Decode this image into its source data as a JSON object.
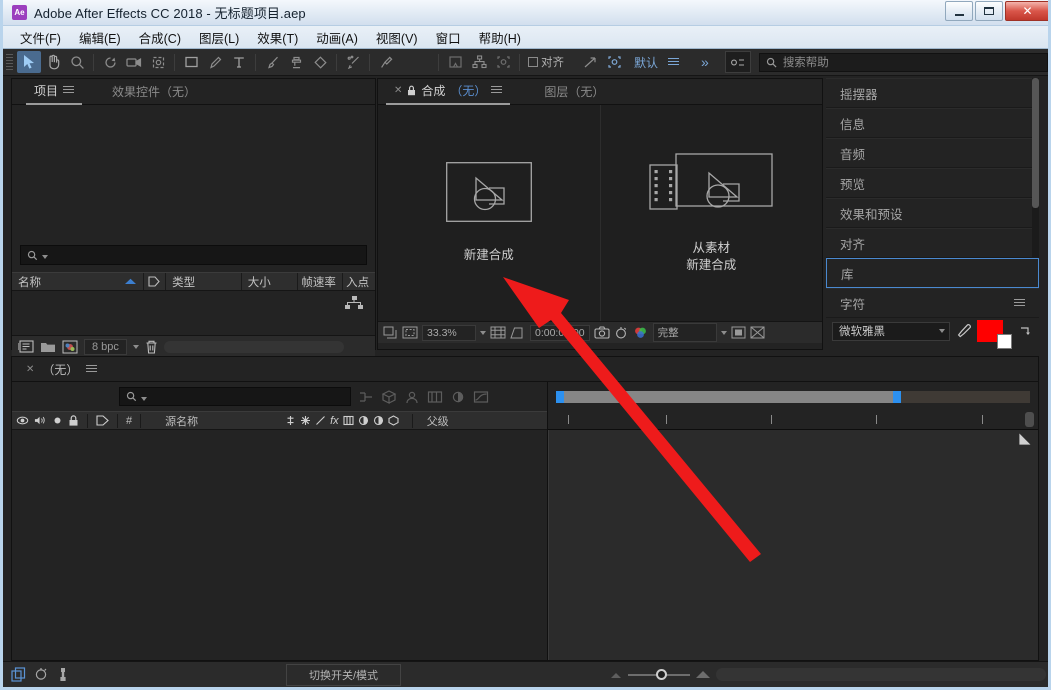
{
  "window": {
    "app_badge": "Ae",
    "title": "Adobe After Effects CC 2018 - 无标题项目.aep",
    "buttons": {
      "minimize": "—",
      "restore": "❐",
      "close": "✕"
    }
  },
  "menubar": {
    "items": [
      {
        "label": "文件(F)"
      },
      {
        "label": "编辑(E)"
      },
      {
        "label": "合成(C)"
      },
      {
        "label": "图层(L)"
      },
      {
        "label": "效果(T)"
      },
      {
        "label": "动画(A)"
      },
      {
        "label": "视图(V)"
      },
      {
        "label": "窗口"
      },
      {
        "label": "帮助(H)"
      }
    ]
  },
  "toolbar": {
    "tools": [
      {
        "name": "selection-tool",
        "active": true
      },
      {
        "name": "hand-tool",
        "active": false
      },
      {
        "name": "zoom-tool",
        "active": false
      },
      {
        "name": "rotation-tool",
        "active": false
      },
      {
        "name": "camera-tool",
        "active": false
      },
      {
        "name": "pan-behind-tool",
        "active": false
      },
      {
        "name": "shape-tool",
        "active": false
      },
      {
        "name": "pen-tool",
        "active": false
      },
      {
        "name": "type-tool",
        "active": false
      },
      {
        "name": "brush-tool",
        "active": false
      },
      {
        "name": "clone-stamp-tool",
        "active": false
      },
      {
        "name": "eraser-tool",
        "active": false
      },
      {
        "name": "roto-brush-tool",
        "active": false
      },
      {
        "name": "puppet-pin-tool",
        "active": false
      }
    ],
    "snap_label": "对齐",
    "workspace_name": "默认",
    "overflow_label": "»",
    "search_placeholder": "搜索帮助"
  },
  "project_panel": {
    "tabs": [
      {
        "label": "项目",
        "active": true
      },
      {
        "label": "效果控件（无）",
        "active": false
      }
    ],
    "search_placeholder": "",
    "columns": [
      "名称",
      "类型",
      "大小",
      "帧速率",
      "入点"
    ],
    "rows": [],
    "footer": {
      "bit_depth": "8 bpc"
    }
  },
  "comp_panel": {
    "tabs": [
      {
        "label": "合成",
        "suffix": "（无）",
        "active": true
      },
      {
        "label": "图层（无）",
        "active": false
      }
    ],
    "actions": [
      {
        "name": "new-composition",
        "label": "新建合成",
        "icon": "composition-icon"
      },
      {
        "name": "new-composition-from-footage",
        "label": "从素材\n新建合成",
        "icon": "footage-composition-icon"
      }
    ],
    "action_1_line1": "从素材",
    "action_1_line2": "新建合成",
    "footer": {
      "zoom": "33.3%",
      "timecode": "0:00:00:00",
      "quality": "完整"
    }
  },
  "right_sidebar": {
    "items": [
      {
        "label": "摇摆器",
        "selected": false
      },
      {
        "label": "信息",
        "selected": false
      },
      {
        "label": "音频",
        "selected": false
      },
      {
        "label": "预览",
        "selected": false
      },
      {
        "label": "效果和预设",
        "selected": false
      },
      {
        "label": "对齐",
        "selected": false
      },
      {
        "label": "库",
        "selected": true
      },
      {
        "label": "字符",
        "selected": false,
        "has_menu": true
      }
    ],
    "character": {
      "font": "微软雅黑",
      "fill_color": "#ff0000",
      "stroke_color": "#ffffff"
    }
  },
  "timeline": {
    "tab_label": "（无）",
    "search_placeholder": "",
    "columns": {
      "source_name": "源名称",
      "parent": "父级",
      "hash": "#"
    },
    "layers": []
  },
  "statusbar": {
    "toggle_label": "切换开关/模式"
  },
  "annotation": {
    "arrow_color": "#ee1b1b",
    "points_to": "新建合成"
  },
  "colors": {
    "panel_bg": "#232323",
    "toolbar_bg": "#2b2b2b",
    "accent_blue": "#4a89d0",
    "text_primary": "#cfcfcf",
    "text_muted": "#8b8b8b",
    "selection_blue": "#2c90ef"
  }
}
